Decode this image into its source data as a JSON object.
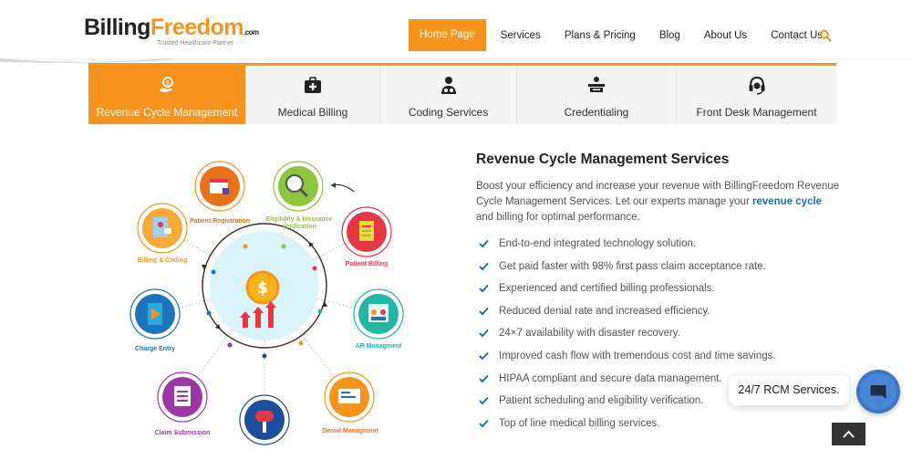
{
  "brand": {
    "part1": "Billing",
    "part2": "Freedom",
    "suffix": ".com",
    "tagline": "Trusted Healthcare Partner"
  },
  "nav": [
    "Home Page",
    "Services",
    "Plans & Pricing",
    "Blog",
    "About Us",
    "Contact Us"
  ],
  "tabs": [
    {
      "label": "Revenue Cycle Management",
      "icon": "hand-coin-icon"
    },
    {
      "label": "Medical Billing",
      "icon": "medical-kit-icon"
    },
    {
      "label": "Coding Services",
      "icon": "coder-icon"
    },
    {
      "label": "Credentialing",
      "icon": "credential-icon"
    },
    {
      "label": "Front Desk Management",
      "icon": "headset-icon"
    }
  ],
  "diagram": {
    "labels": {
      "patient_registration": "Patient Registration",
      "eligibility_line1": "Eligibility & Insurance",
      "eligibility_line2": "Verification",
      "patient_billing": "Patient Billing",
      "billing_coding": "Billing & Coding",
      "ar_management": "AR Managment",
      "charge_entry": "Charge Entry",
      "claim_submission": "Claim Submission",
      "denial_management": "Denial Managment"
    },
    "center_symbol": "$",
    "colors": {
      "orange": "#f7941d",
      "green": "#8cc63f",
      "red": "#e53845",
      "teal": "#23b5a6",
      "blue": "#1c75bc",
      "purple": "#9e37a6",
      "navy": "#1b4f9c",
      "center": "#d9f4fb"
    }
  },
  "content": {
    "title": "Revenue Cycle Management Services",
    "intro_before": "Boost your efficiency and increase your revenue with BillingFreedom Revenue Cycle Management Services. Let our experts manage your ",
    "intro_link": "revenue cycle",
    "intro_after": " and billing for optimal performance.",
    "checks": [
      "End-to-end integrated technology solution.",
      "Get paid faster with 98% first pass claim acceptance rate.",
      "Experienced and certified billing professionals.",
      "Reduced denial rate and increased efficiency.",
      "24×7 availability with disaster recovery.",
      "Improved cash flow with tremendous cost and time savings.",
      "HIPAA compliant and secure data management.",
      "Patient scheduling and eligibility verification.",
      "Top of line medical billing services."
    ]
  },
  "chat": {
    "bubble_text": "24/7 RCM Services."
  },
  "colors": {
    "accent": "#f7941d",
    "link": "#1a73b8",
    "check": "#1a73b8"
  }
}
